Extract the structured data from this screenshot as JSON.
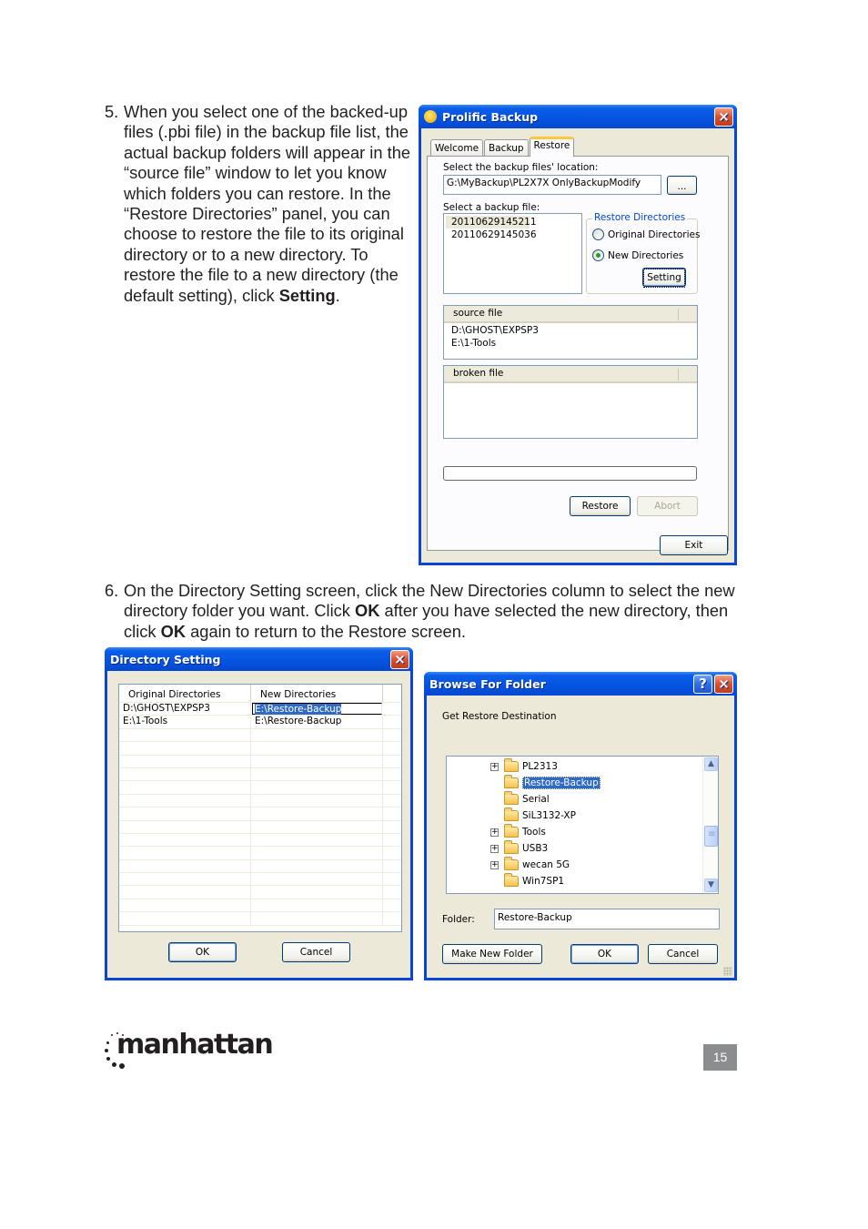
{
  "steps": {
    "step5": {
      "number": "5.",
      "text": "When you select one of the backed-up files (.pbi file) in the backup file list, the actual backup folders will appear in the “source file” window to let you know which folders you can restore. In the “Restore Directories” panel, you can choose to restore the file to its original directory or to a new directory. To restore the file to a new directory (the default setting), click ",
      "bold": "Setting",
      "tail": "."
    },
    "step6": {
      "number": "6.",
      "text_a": "On the Directory Setting screen, click the New Directories column to select the new directory folder you want. Click ",
      "bold_a": "OK",
      "text_b": " after you have selected the new directory, then click ",
      "bold_b": "OK",
      "text_c": " again to return to the Restore screen."
    }
  },
  "prolific": {
    "title": "Prolific Backup",
    "close_icon": "×",
    "tabs": [
      {
        "label": "Welcome",
        "active": false
      },
      {
        "label": "Backup",
        "active": false
      },
      {
        "label": "Restore",
        "active": true
      }
    ],
    "location_label": "Select the backup files' location:",
    "location_value": "G:\\MyBackup\\PL2X7X OnlyBackupModify",
    "browse_label": "...",
    "select_file_label": "Select a backup file:",
    "backup_files": [
      "20110629145211",
      "20110629145036"
    ],
    "restore_dirs": {
      "legend": "Restore Directories",
      "original_label": "Original Directories",
      "new_label": "New Directories",
      "selected": "New Directories",
      "setting_label": "Setting"
    },
    "source_file": {
      "header": "source file",
      "rows": [
        "D:\\GHOST\\EXPSP3",
        "E:\\1-Tools"
      ]
    },
    "broken_file": {
      "header": "broken file",
      "rows": []
    },
    "progress": 0,
    "restore_label": "Restore",
    "abort_label": "Abort",
    "exit_label": "Exit"
  },
  "dirset": {
    "title": "Directory Setting",
    "close_icon": "×",
    "columns": [
      "Original Directories",
      "New Directories"
    ],
    "rows": [
      {
        "original": "D:\\GHOST\\EXPSP3",
        "new": "E:\\Restore-Backup",
        "editing": true
      },
      {
        "original": "E:\\1-Tools",
        "new": "E:\\Restore-Backup",
        "editing": false
      }
    ],
    "ok_label": "OK",
    "cancel_label": "Cancel"
  },
  "browse": {
    "title": "Browse For Folder",
    "help_icon": "?",
    "close_icon": "×",
    "prompt": "Get Restore Destination",
    "tree": [
      {
        "label": "PL2313",
        "expandable": true,
        "selected": false
      },
      {
        "label": "Restore-Backup",
        "expandable": false,
        "selected": true
      },
      {
        "label": "Serial",
        "expandable": false,
        "selected": false
      },
      {
        "label": "SiL3132-XP",
        "expandable": false,
        "selected": false
      },
      {
        "label": "Tools",
        "expandable": true,
        "selected": false
      },
      {
        "label": "USB3",
        "expandable": true,
        "selected": false
      },
      {
        "label": "wecan 5G",
        "expandable": true,
        "selected": false
      },
      {
        "label": "Win7SP1",
        "expandable": false,
        "selected": false
      }
    ],
    "expander_glyph": "+",
    "scroll_up": "▲",
    "scroll_down": "▼",
    "folder_label": "Folder:",
    "folder_value": "Restore-Backup",
    "make_new_folder_label": "Make New Folder",
    "ok_label": "OK",
    "cancel_label": "Cancel"
  },
  "footer": {
    "brand": "manhattan",
    "page_number": "15"
  }
}
